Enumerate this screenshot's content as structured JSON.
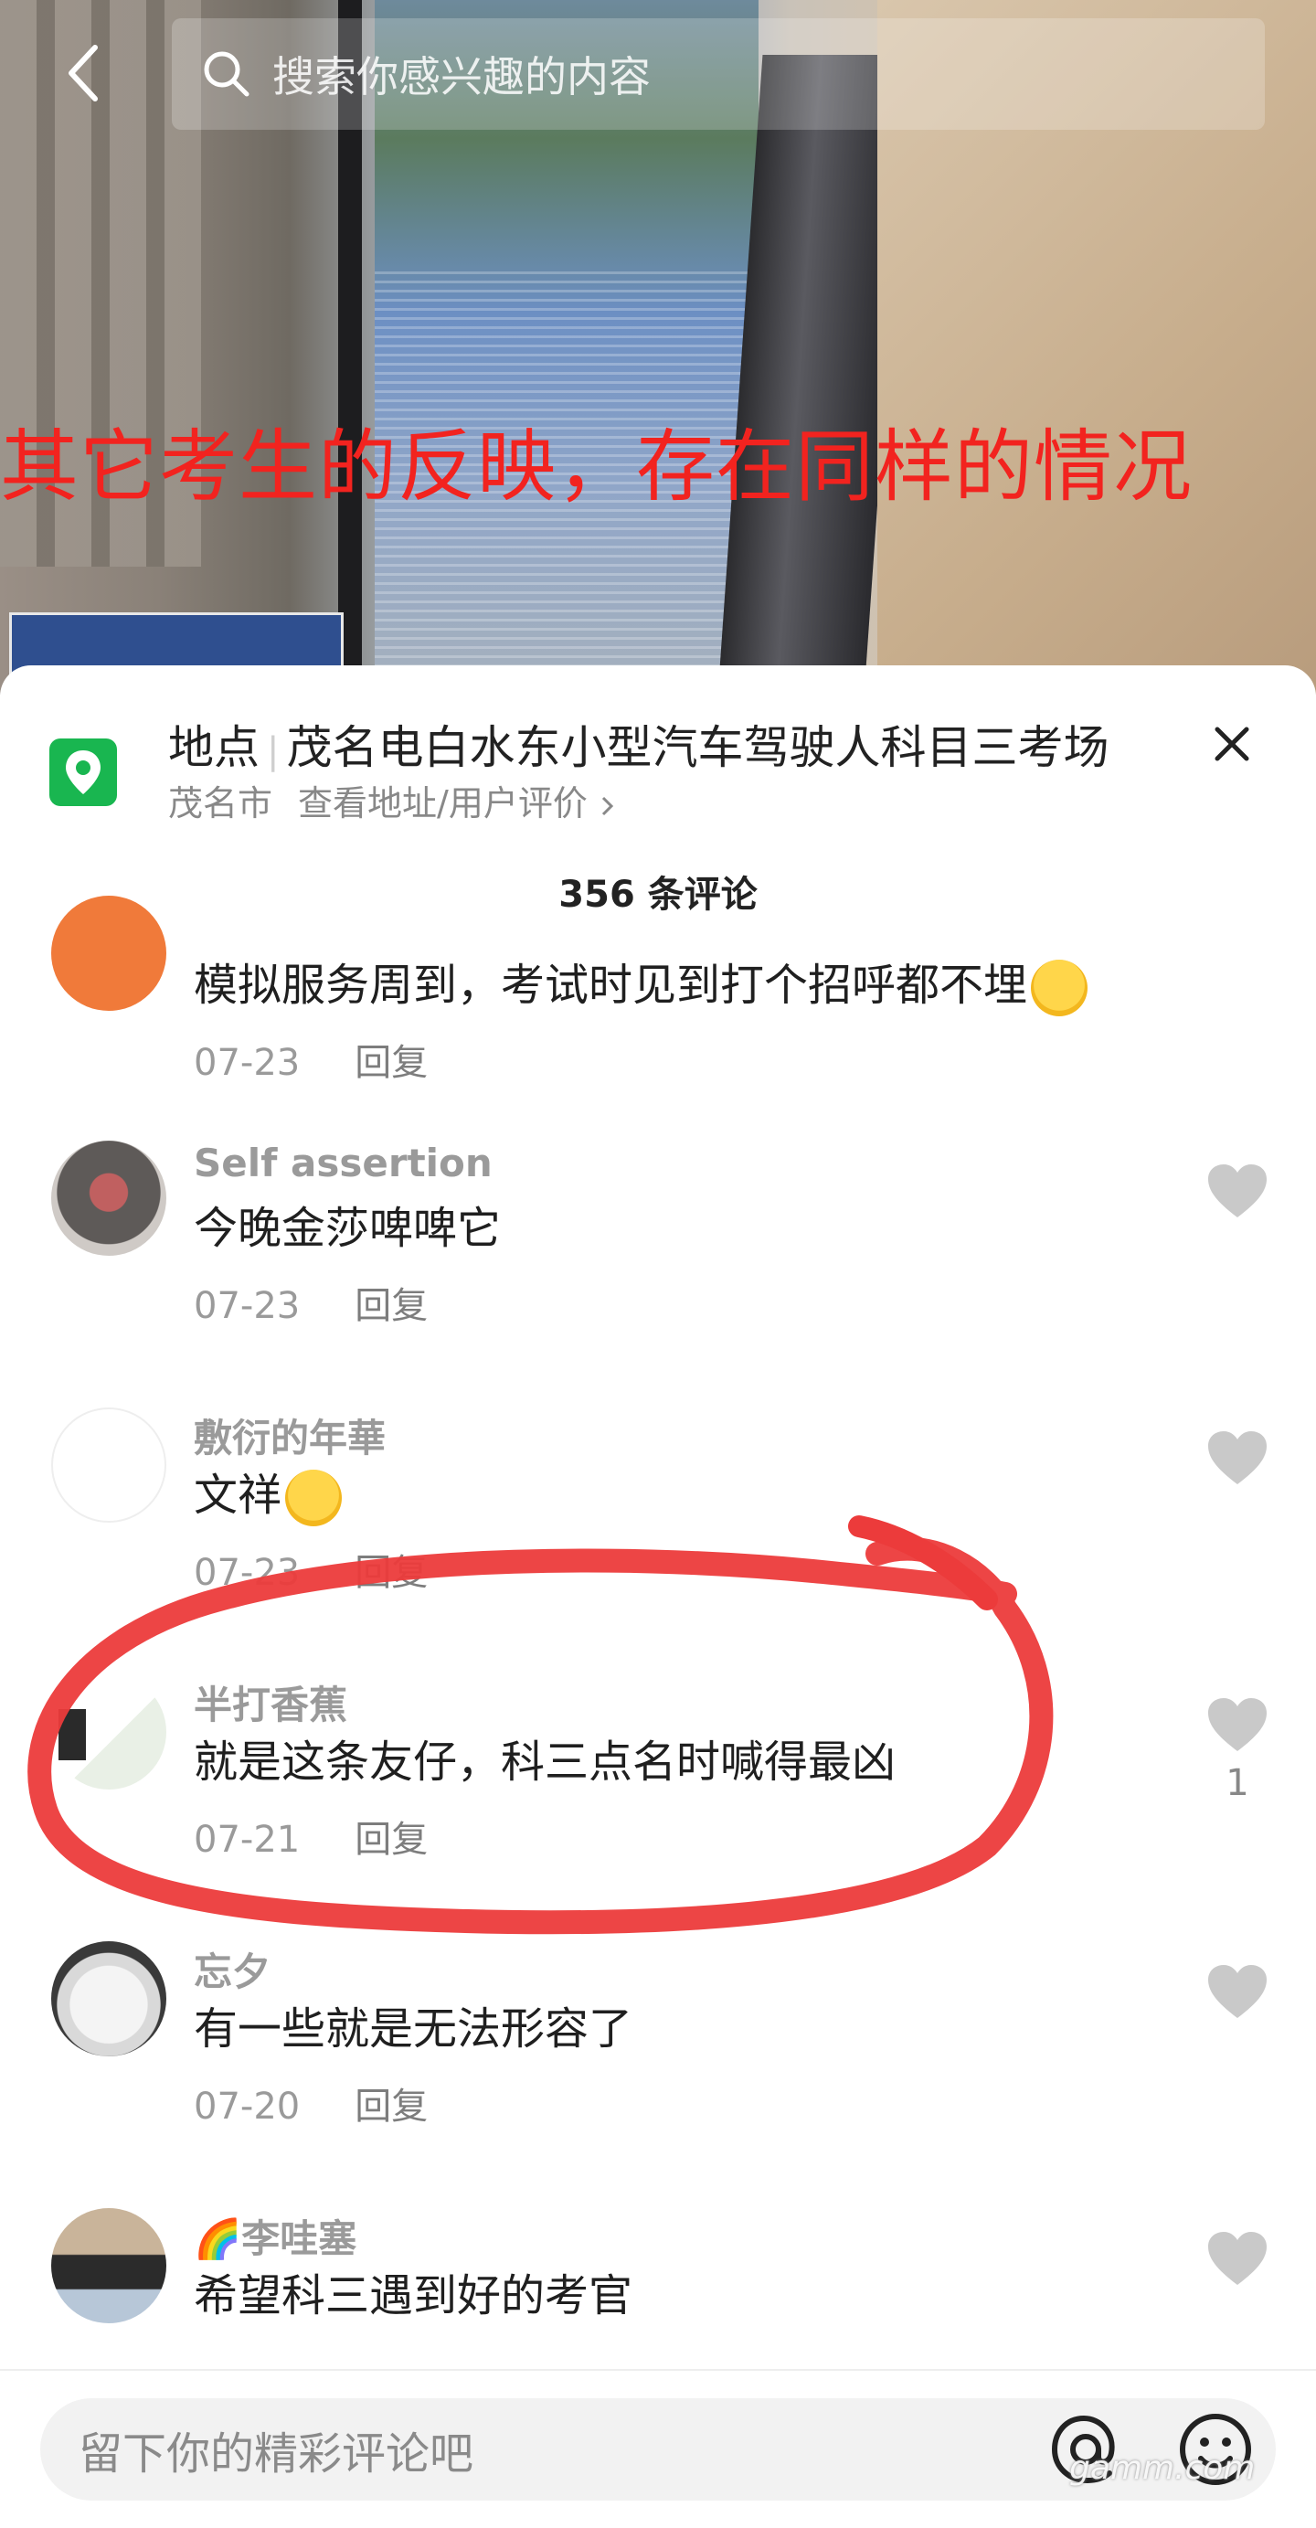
{
  "search": {
    "placeholder": "搜索你感兴趣的内容"
  },
  "video": {
    "overlay_text": "其它考生的反映，存在同样的情况"
  },
  "location": {
    "label": "地点",
    "name": "茂名电白水东小型汽车驾驶人科目三考场",
    "city": "茂名市",
    "link": "查看地址/用户评价",
    "color": "#19b650"
  },
  "comments_header": {
    "count_text": "356 条评论"
  },
  "comments": [
    {
      "user": "",
      "text": "模拟服务周到，考试时见到打个招呼都不埋",
      "date": "07-23",
      "reply": "回复",
      "avatar": "orange-avatar"
    },
    {
      "user": "Self assertion",
      "text": "今晚金莎啤啤它",
      "date": "07-23",
      "reply": "回复",
      "avatar": "person-avatar"
    },
    {
      "user": "敷衍的年華",
      "text": "文祥",
      "date": "07-23",
      "reply": "回复",
      "avatar": "blank-avatar"
    },
    {
      "user": "半打香蕉",
      "text": "就是这条友仔，科三点名时喊得最凶",
      "date": "07-21",
      "reply": "回复",
      "likes": "1",
      "avatar": "book-avatar"
    },
    {
      "user": "忘夕",
      "text": "有一些就是无法形容了",
      "date": "07-20",
      "reply": "回复",
      "avatar": "meme-avatar"
    },
    {
      "user": "🌈李哇塞",
      "text": "希望科三遇到好的考官",
      "date": "",
      "reply": "",
      "avatar": "photo-avatar"
    }
  ],
  "bottom": {
    "input_placeholder": "留下你的精彩评论吧",
    "watermark": "gamm.com"
  },
  "colors": {
    "annotation_red": "#ec3b3b",
    "overlay_red": "#f2231f"
  }
}
